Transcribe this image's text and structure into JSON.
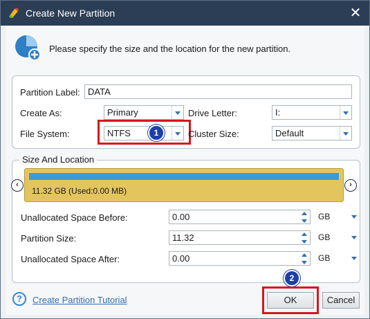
{
  "window": {
    "title": "Create New Partition",
    "close_glyph": "✕"
  },
  "header": {
    "text": "Please specify the size and the location for the new partition.",
    "icon": "partition-add-icon"
  },
  "form": {
    "partition_label": {
      "label": "Partition Label:",
      "value": "DATA"
    },
    "create_as": {
      "label": "Create As:",
      "value": "Primary"
    },
    "drive_letter": {
      "label": "Drive Letter:",
      "value": "I:"
    },
    "file_system": {
      "label": "File System:",
      "value": "NTFS"
    },
    "cluster_size": {
      "label": "Cluster Size:",
      "value": "Default"
    }
  },
  "size_location": {
    "title": "Size And Location",
    "disk_text": "11.32 GB (Used:0.00 MB)",
    "unallocated_before": {
      "label": "Unallocated Space Before:",
      "value": "0.00",
      "unit": "GB"
    },
    "partition_size": {
      "label": "Partition Size:",
      "value": "11.32",
      "unit": "GB"
    },
    "unallocated_after": {
      "label": "Unallocated Space After:",
      "value": "0.00",
      "unit": "GB"
    }
  },
  "annotations": {
    "badge1": "1",
    "badge2": "2",
    "highlight_color": "#d8141c",
    "badge_color": "#1d3fa8"
  },
  "footer": {
    "tutorial_link": "Create Partition Tutorial",
    "ok": "OK",
    "cancel": "Cancel"
  },
  "colors": {
    "titlebar": "#2c3e55",
    "disk_fill": "#e3c55e",
    "disk_bar": "#3b9ad8",
    "accent": "#2f6fb0"
  }
}
